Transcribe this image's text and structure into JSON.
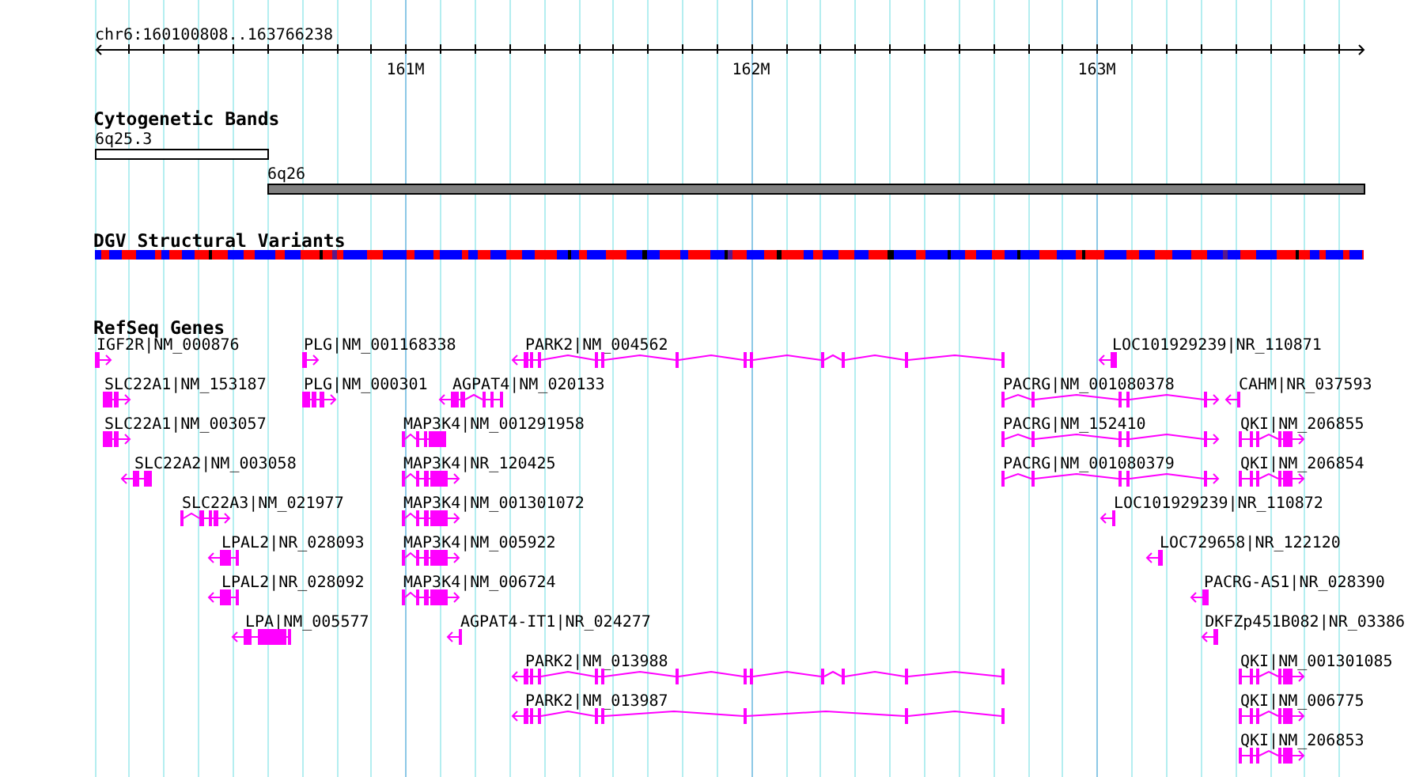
{
  "ruler": {
    "location": "chr6:160100808..163766238",
    "ticks": [
      "161M",
      "162M",
      "163M"
    ]
  },
  "tracks": [
    {
      "kind": "bands",
      "title": "Cytogenetic Bands",
      "bands": [
        {
          "label": "6q25.3",
          "color": "#ffffff"
        },
        {
          "label": "6q26",
          "color": "#808080"
        }
      ]
    },
    {
      "kind": "variants",
      "title": "DGV Structural Variants"
    },
    {
      "kind": "genes",
      "title": "RefSeq Genes",
      "rows": [
        {
          "genes": [
            {
              "label": "IGF2R|NM_000876",
              "kind": "forward"
            },
            {
              "label": "PLG|NM_001168338",
              "kind": "forward"
            },
            {
              "label": "PARK2|NM_004562",
              "kind": "reverse"
            },
            {
              "label": "LOC101929239|NR_110871",
              "kind": "reverse"
            }
          ]
        },
        {
          "genes": [
            {
              "label": "SLC22A1|NM_153187",
              "kind": "forward"
            },
            {
              "label": "PLG|NM_000301",
              "kind": "forward"
            },
            {
              "label": "AGPAT4|NM_020133",
              "kind": "reverse"
            },
            {
              "label": "PACRG|NM_001080378",
              "kind": "forward"
            },
            {
              "label": "CAHM|NR_037593",
              "kind": "reverse"
            }
          ]
        },
        {
          "genes": [
            {
              "label": "SLC22A1|NM_003057",
              "kind": "forward"
            },
            {
              "label": "MAP3K4|NM_001291958",
              "kind": "unstranded"
            },
            {
              "label": "PACRG|NM_152410",
              "kind": "forward"
            },
            {
              "label": "QKI|NM_206855",
              "kind": "forward"
            }
          ]
        },
        {
          "genes": [
            {
              "label": "SLC22A2|NM_003058",
              "kind": "reverse"
            },
            {
              "label": "MAP3K4|NR_120425",
              "kind": "forward"
            },
            {
              "label": "PACRG|NM_001080379",
              "kind": "forward"
            },
            {
              "label": "QKI|NM_206854",
              "kind": "forward"
            }
          ]
        },
        {
          "genes": [
            {
              "label": "SLC22A3|NM_021977",
              "kind": "forward"
            },
            {
              "label": "MAP3K4|NM_001301072",
              "kind": "forward"
            },
            {
              "label": "LOC101929239|NR_110872",
              "kind": "reverse"
            }
          ]
        },
        {
          "genes": [
            {
              "label": "LPAL2|NR_028093",
              "kind": "reverse"
            },
            {
              "label": "MAP3K4|NM_005922",
              "kind": "forward"
            },
            {
              "label": "LOC729658|NR_122120",
              "kind": "reverse"
            }
          ]
        },
        {
          "genes": [
            {
              "label": "LPAL2|NR_028092",
              "kind": "reverse"
            },
            {
              "label": "MAP3K4|NM_006724",
              "kind": "forward"
            },
            {
              "label": "PACRG-AS1|NR_028390",
              "kind": "reverse"
            }
          ]
        },
        {
          "genes": [
            {
              "label": "LPA|NM_005577",
              "kind": "reverse"
            },
            {
              "label": "AGPAT4-IT1|NR_024277",
              "kind": "reverse"
            },
            {
              "label": "DKFZp451B082|NR_03386",
              "kind": "reverse"
            }
          ]
        },
        {
          "genes": [
            {
              "label": "PARK2|NM_013988",
              "kind": "reverse"
            },
            {
              "label": "QKI|NM_001301085",
              "kind": "forward"
            }
          ]
        },
        {
          "genes": [
            {
              "label": "PARK2|NM_013987",
              "kind": "reverse"
            },
            {
              "label": "QKI|NM_006775",
              "kind": "forward"
            }
          ]
        },
        {
          "genes": [
            {
              "label": "QKI|NM_206853",
              "kind": "forward"
            }
          ]
        }
      ]
    }
  ]
}
